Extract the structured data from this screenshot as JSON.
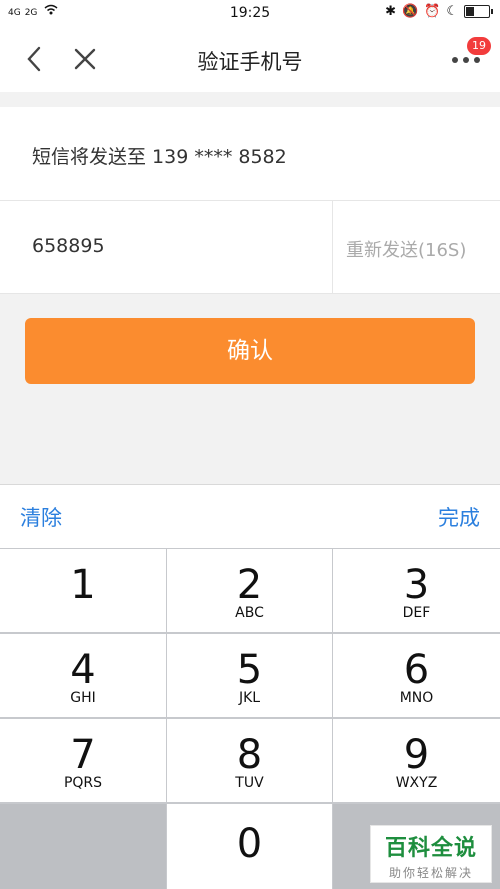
{
  "statusbar": {
    "signal1": "4G",
    "signal2": "2G",
    "time": "19:25",
    "icons": [
      "bluetooth-icon",
      "mute-icon",
      "alarm-icon",
      "moon-icon",
      "battery-icon"
    ]
  },
  "navbar": {
    "title": "验证手机号",
    "badge_count": "19",
    "back_icon": "back-chevron",
    "close_icon": "close-x",
    "more_icon": "ellipsis"
  },
  "sms": {
    "text": "短信将发送至 139 **** 8582"
  },
  "code": {
    "value": "658895",
    "resend_label": "重新发送(16S)"
  },
  "confirm": {
    "label": "确认",
    "color": "#fb8c2f"
  },
  "keyboard": {
    "clear_label": "清除",
    "done_label": "完成",
    "accent_color": "#2b7fde",
    "keys": [
      {
        "num": "1",
        "letters": ""
      },
      {
        "num": "2",
        "letters": "ABC"
      },
      {
        "num": "3",
        "letters": "DEF"
      },
      {
        "num": "4",
        "letters": "GHI"
      },
      {
        "num": "5",
        "letters": "JKL"
      },
      {
        "num": "6",
        "letters": "MNO"
      },
      {
        "num": "7",
        "letters": "PQRS"
      },
      {
        "num": "8",
        "letters": "TUV"
      },
      {
        "num": "9",
        "letters": "WXYZ"
      },
      {
        "num": "0",
        "letters": ""
      }
    ]
  },
  "watermark": {
    "title": "百科全说",
    "subtitle": "助你轻松解决"
  }
}
